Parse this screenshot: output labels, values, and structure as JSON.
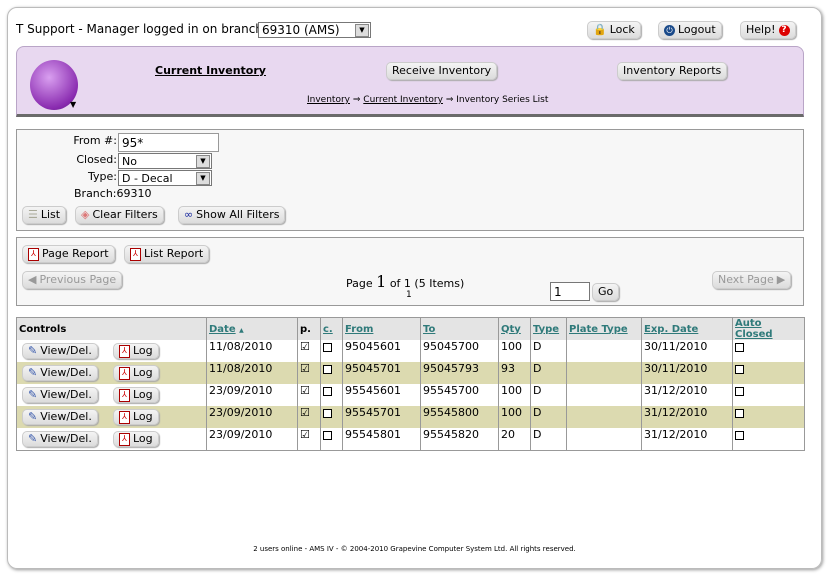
{
  "header": {
    "login_text": "T Support - Manager logged in on branch:",
    "branch_select": "69310 (AMS)",
    "lock": "Lock",
    "logout": "Logout",
    "help": "Help!"
  },
  "nav": {
    "current": "Current Inventory",
    "receive": "Receive Inventory",
    "reports": "Inventory Reports"
  },
  "breadcrumb": {
    "items": [
      "Inventory",
      "Current Inventory"
    ],
    "sep": "⇒",
    "current": "Inventory Series List"
  },
  "filters": {
    "from_label": "From #:",
    "from_value": "95*",
    "closed_label": "Closed:",
    "closed_value": "No",
    "type_label": "Type:",
    "type_value": "D - Decal",
    "branch_label": "Branch:",
    "branch_value": "69310",
    "list": "List",
    "clear": "Clear Filters",
    "show_all": "Show All Filters"
  },
  "paging": {
    "page_report": "Page Report",
    "list_report": "List Report",
    "prev": "Previous Page",
    "next": "Next Page",
    "page_word": "Page",
    "page_num": "1",
    "of_text": "of 1 (5 Items)",
    "sub_num": "1",
    "go_value": "1",
    "go": "Go"
  },
  "table": {
    "headers": [
      "Controls",
      "Date",
      "p.",
      "c.",
      "From",
      "To",
      "Qty",
      "Type",
      "Plate Type",
      "Exp. Date",
      "Auto Closed"
    ],
    "sort_icon": "▲",
    "view": "View/Del.",
    "log": "Log",
    "rows": [
      {
        "date": "11/08/2010",
        "p": true,
        "c": false,
        "from": "95045601",
        "to": "95045700",
        "qty": "100",
        "type": "D",
        "plate": "",
        "exp": "30/11/2010",
        "auto": false
      },
      {
        "date": "11/08/2010",
        "p": true,
        "c": false,
        "from": "95045701",
        "to": "95045793",
        "qty": "93",
        "type": "D",
        "plate": "",
        "exp": "30/11/2010",
        "auto": false
      },
      {
        "date": "23/09/2010",
        "p": true,
        "c": false,
        "from": "95545601",
        "to": "95545700",
        "qty": "100",
        "type": "D",
        "plate": "",
        "exp": "31/12/2010",
        "auto": false
      },
      {
        "date": "23/09/2010",
        "p": true,
        "c": false,
        "from": "95545701",
        "to": "95545800",
        "qty": "100",
        "type": "D",
        "plate": "",
        "exp": "31/12/2010",
        "auto": false
      },
      {
        "date": "23/09/2010",
        "p": true,
        "c": false,
        "from": "95545801",
        "to": "95545820",
        "qty": "20",
        "type": "D",
        "plate": "",
        "exp": "31/12/2010",
        "auto": false
      }
    ]
  },
  "footer": "2 users online - AMS IV - © 2004-2010 Grapevine Computer System Ltd. All rights reserved.",
  "colors": {
    "band": "#e8d8f0",
    "alt_row": "#dcdab0",
    "link": "#2f7a7a"
  }
}
